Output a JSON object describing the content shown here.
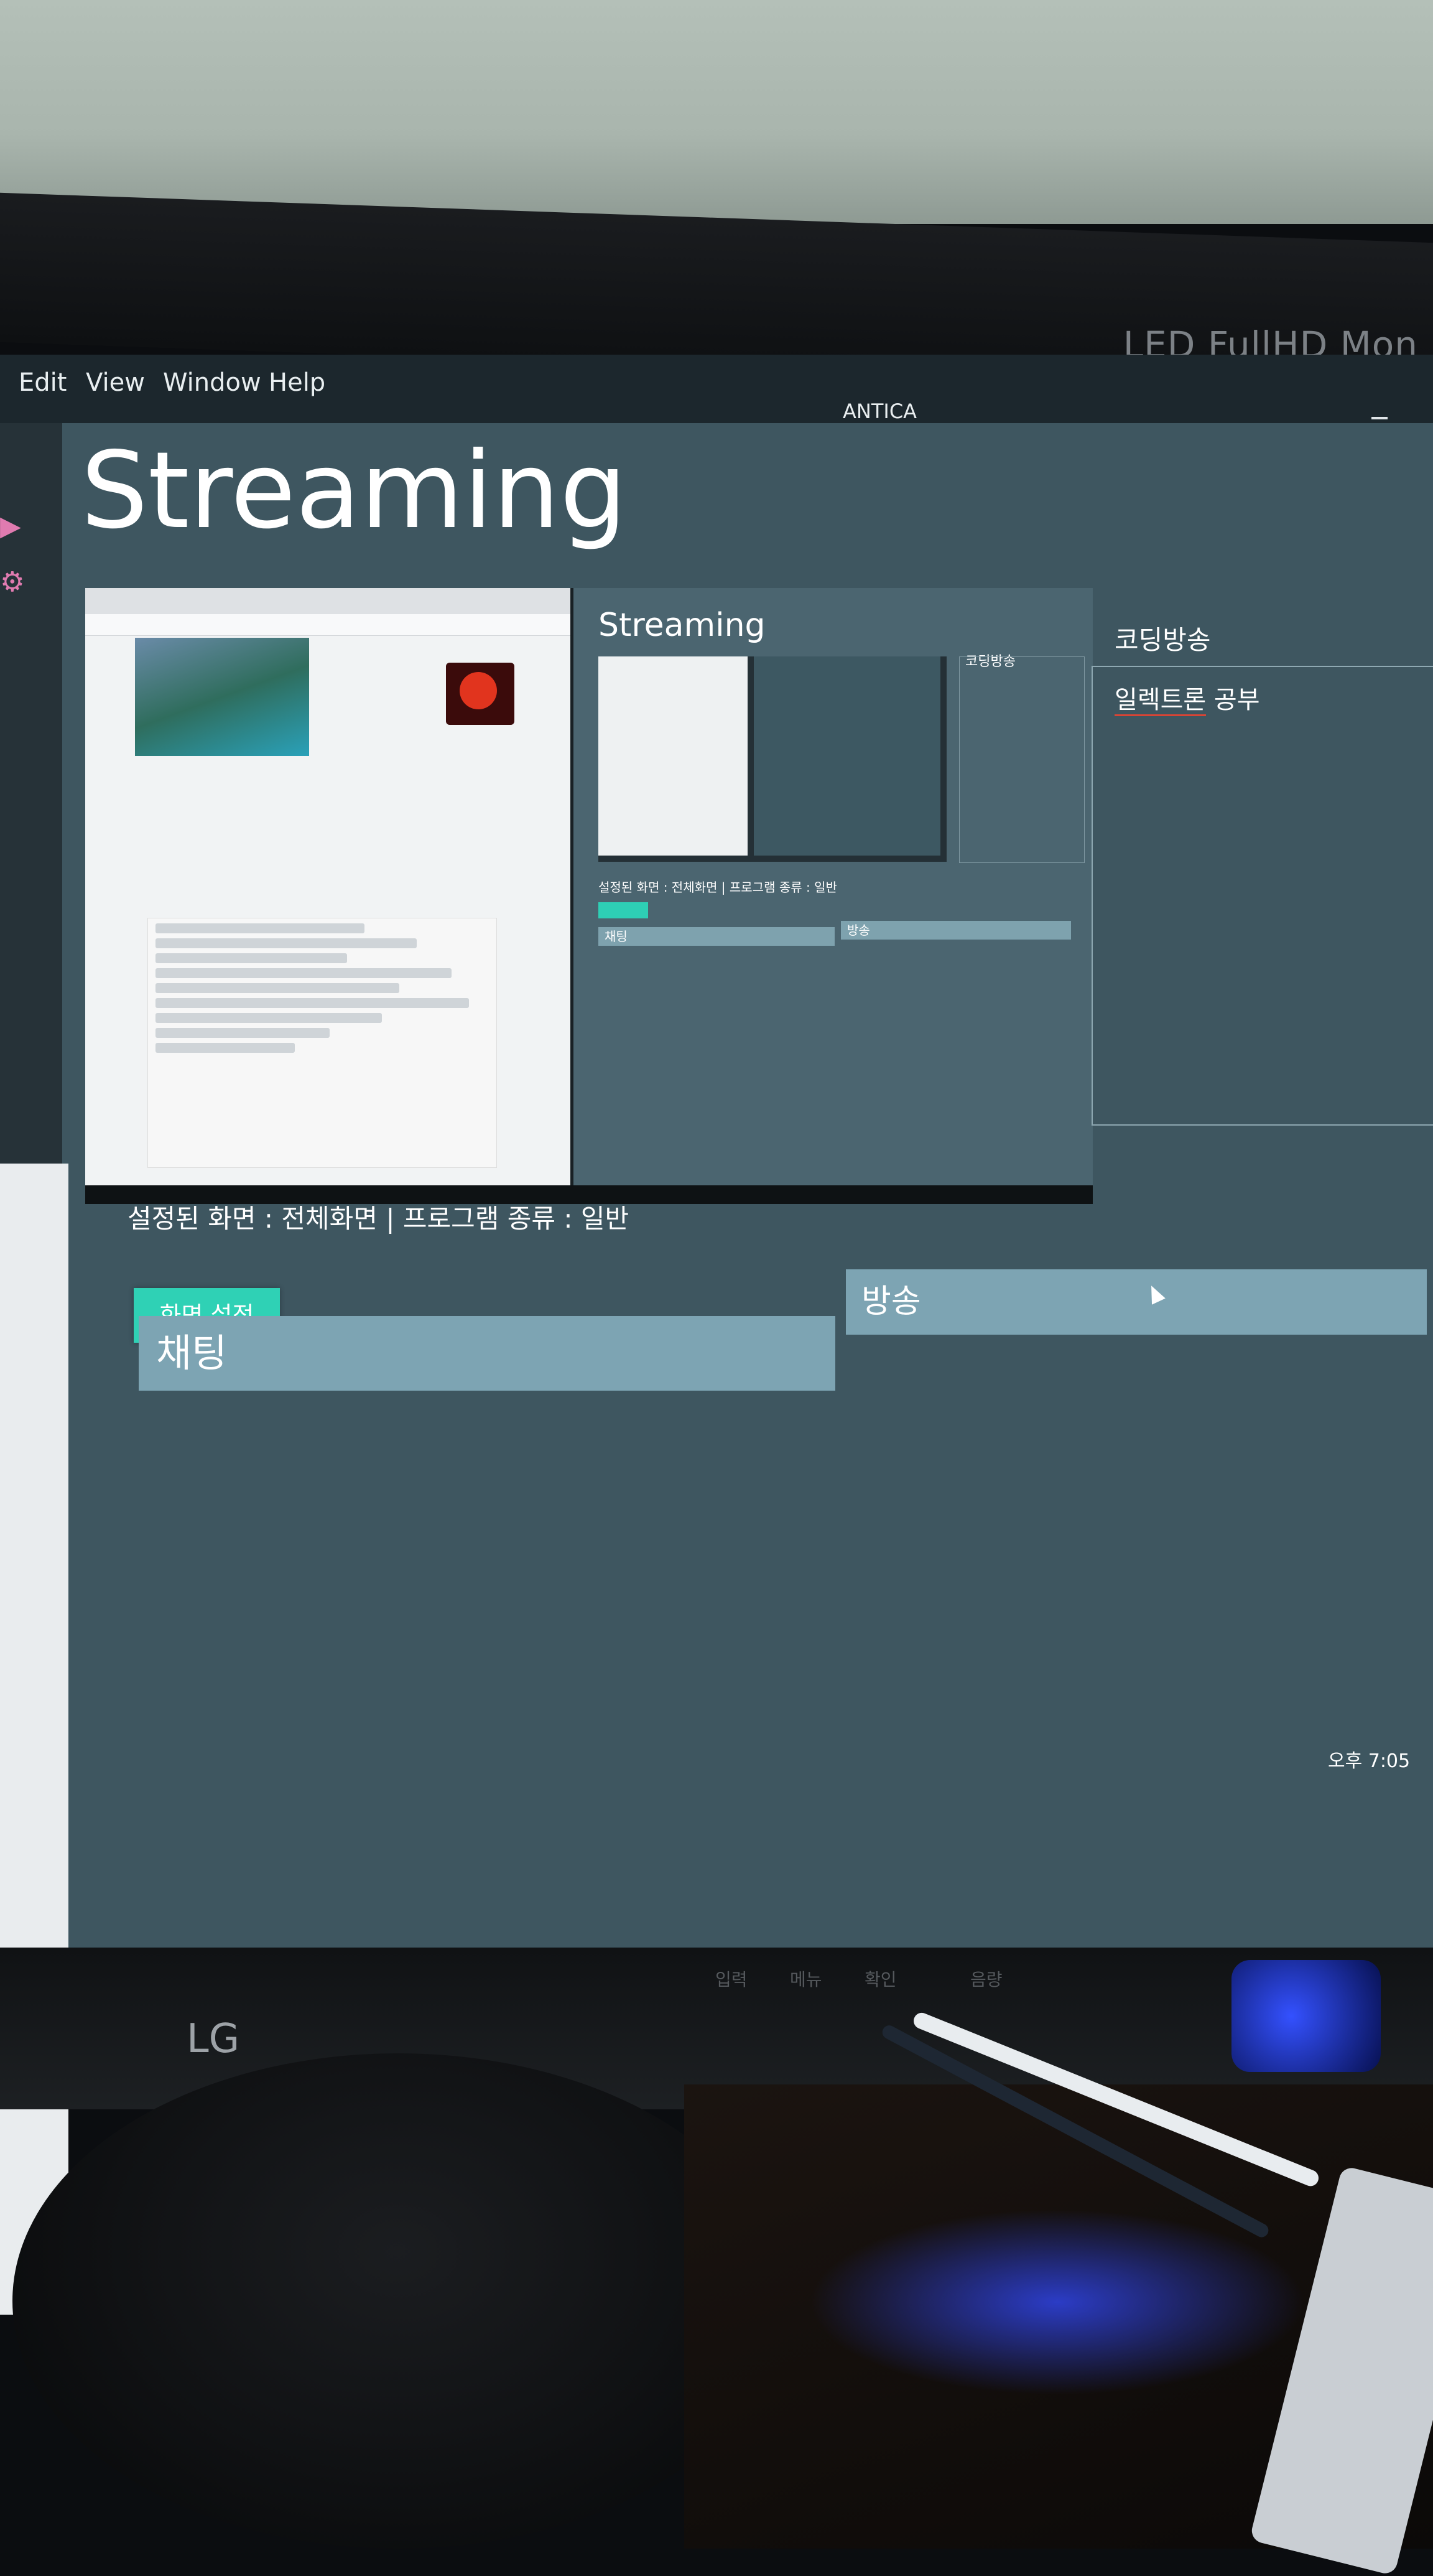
{
  "monitor": {
    "brand_text": "LED FullHD Mon",
    "front_logo": "LG",
    "front_buttons": [
      "입력",
      "메뉴",
      "확인",
      "음량"
    ]
  },
  "menubar": {
    "items": [
      "Edit",
      "View",
      "Window",
      "Help"
    ],
    "window_title": "ANTICA"
  },
  "sidebar": {
    "icons": [
      "broadcast-icon",
      "gear-icon"
    ]
  },
  "page": {
    "title": "Streaming"
  },
  "preview": {
    "app_title": "Streaming",
    "side_title": "코딩방송",
    "status": "설정된 화면 : 전체화면 | 프로그램 종류 : 일반",
    "chat": "채팅",
    "broadcast": "방송"
  },
  "side_panel": {
    "title": "코딩방송",
    "text_underlined": "일렉트론",
    "text_rest": " 공부"
  },
  "status_line": "설정된 화면 : 전체화면 | 프로그램 종류 : 일반",
  "buttons": {
    "screen_setting": "화면 설정"
  },
  "fields": {
    "broadcast": "방송",
    "chat": "채팅"
  },
  "taskbar": {
    "clock": "오후 7:05"
  }
}
